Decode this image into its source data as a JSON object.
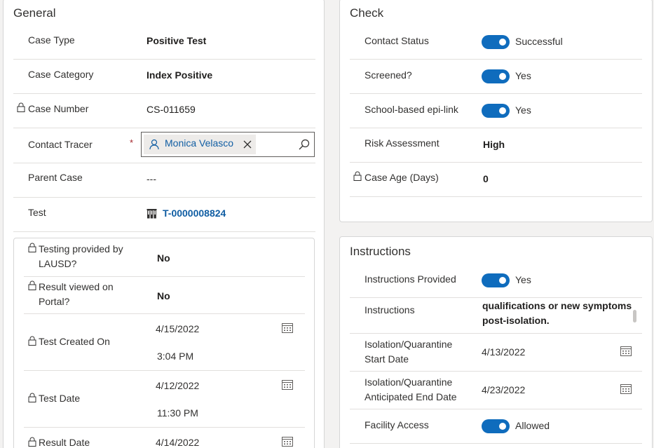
{
  "general": {
    "title": "General",
    "case_type": {
      "label": "Case Type",
      "value": "Positive Test"
    },
    "case_category": {
      "label": "Case Category",
      "value": "Index Positive"
    },
    "case_number": {
      "label": "Case Number",
      "value": "CS-011659"
    },
    "contact_tracer": {
      "label": "Contact Tracer",
      "required_mark": "*",
      "value": "Monica Velasco"
    },
    "parent_case": {
      "label": "Parent Case",
      "value": "---"
    },
    "test": {
      "label": "Test",
      "value": "T-0000008824"
    },
    "sub": {
      "testing_provided": {
        "label_line1": "Testing provided by",
        "label_line2": "LAUSD?",
        "value": "No"
      },
      "result_viewed": {
        "label_line1": "Result viewed on",
        "label_line2": "Portal?",
        "value": "No"
      },
      "test_created_on": {
        "label": "Test Created On",
        "date": "4/15/2022",
        "time": "3:04 PM"
      },
      "test_date": {
        "label": "Test Date",
        "date": "4/12/2022",
        "time": "11:30 PM"
      },
      "result_date": {
        "label": "Result Date",
        "date": "4/14/2022"
      }
    }
  },
  "check": {
    "title": "Check",
    "contact_status": {
      "label": "Contact Status",
      "value": "Successful"
    },
    "screened": {
      "label": "Screened?",
      "value": "Yes"
    },
    "epi_link": {
      "label": "School-based epi-link",
      "value": "Yes"
    },
    "risk_assessment": {
      "label": "Risk Assessment",
      "value": "High"
    },
    "case_age": {
      "label": "Case Age (Days)",
      "value": "0"
    }
  },
  "instructions": {
    "title": "Instructions",
    "provided": {
      "label": "Instructions Provided",
      "value": "Yes"
    },
    "text": {
      "label": "Instructions",
      "line1": "qualifications or new symptoms",
      "line2": "post-isolation."
    },
    "iso_start": {
      "label_line1": "Isolation/Quarantine",
      "label_line2": "Start Date",
      "value": "4/13/2022"
    },
    "iso_end": {
      "label_line1": "Isolation/Quarantine",
      "label_line2": "Anticipated End Date",
      "value": "4/23/2022"
    },
    "facility_access": {
      "label": "Facility Access",
      "value": "Allowed"
    }
  },
  "colors": {
    "accent": "#0f6cbd",
    "link": "#115ea3",
    "required": "#a4262c"
  }
}
